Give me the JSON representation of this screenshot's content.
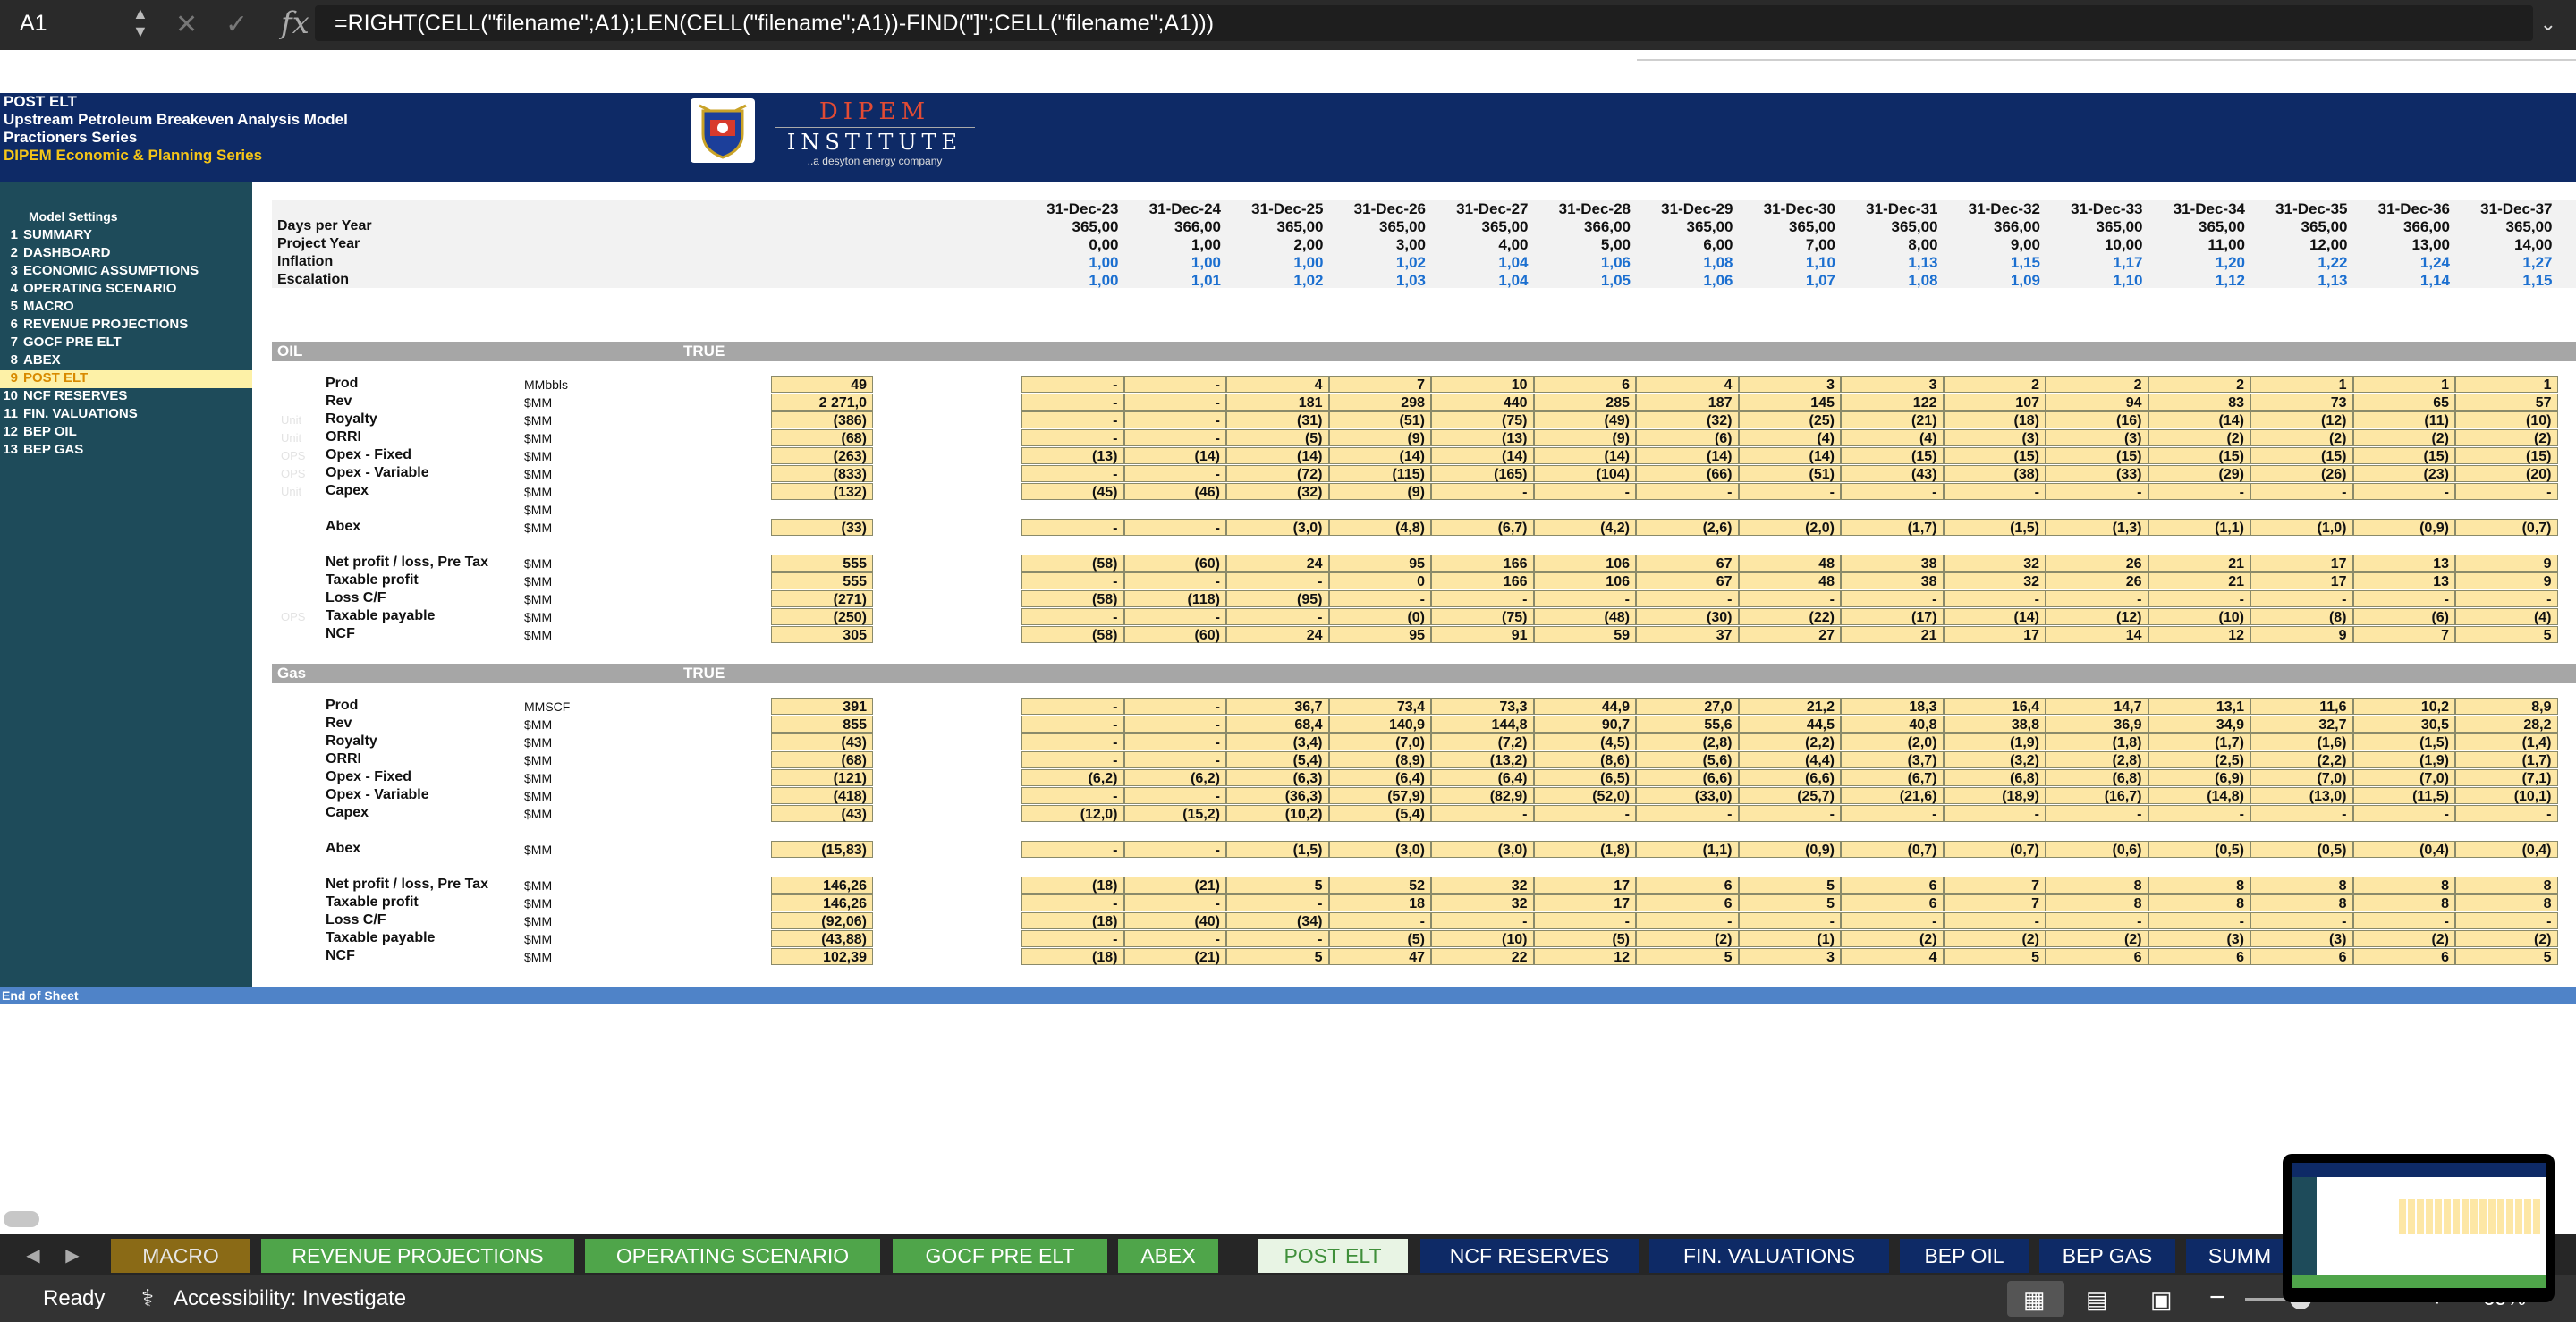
{
  "formula_bar": {
    "cell_ref": "A1",
    "fx": "fx",
    "formula": "=RIGHT(CELL(\"filename\";A1);LEN(CELL(\"filename\";A1))-FIND(\"]\";CELL(\"filename\";A1)))"
  },
  "header": {
    "sheet_name": "POST ELT",
    "title": "Upstream Petroleum Breakeven Analysis Model",
    "series1": "Practioners Series",
    "series2": "DIPEM Economic & Planning Series",
    "logo_title": "DIPEM",
    "logo_sub": "INSTITUTE",
    "logo_tagline": "..a desyton energy company"
  },
  "nav": {
    "settings_label": "Model Settings",
    "items": [
      {
        "num": "1",
        "label": "SUMMARY"
      },
      {
        "num": "2",
        "label": "DASHBOARD"
      },
      {
        "num": "3",
        "label": "ECONOMIC ASSUMPTIONS"
      },
      {
        "num": "4",
        "label": "OPERATING SCENARIO"
      },
      {
        "num": "5",
        "label": "MACRO"
      },
      {
        "num": "6",
        "label": "REVENUE PROJECTIONS"
      },
      {
        "num": "7",
        "label": "GOCF PRE ELT"
      },
      {
        "num": "8",
        "label": "ABEX"
      },
      {
        "num": "9",
        "label": "POST ELT"
      },
      {
        "num": "10",
        "label": "NCF RESERVES"
      },
      {
        "num": "11",
        "label": "FIN. VALUATIONS"
      },
      {
        "num": "12",
        "label": "BEP OIL"
      },
      {
        "num": "13",
        "label": "BEP GAS"
      }
    ],
    "active_index": 8
  },
  "dates": [
    "31-Dec-23",
    "31-Dec-24",
    "31-Dec-25",
    "31-Dec-26",
    "31-Dec-27",
    "31-Dec-28",
    "31-Dec-29",
    "31-Dec-30",
    "31-Dec-31",
    "31-Dec-32",
    "31-Dec-33",
    "31-Dec-34",
    "31-Dec-35",
    "31-Dec-36",
    "31-Dec-37"
  ],
  "header_rows": [
    {
      "label": "Days per Year",
      "blue": false,
      "values": [
        "365,00",
        "366,00",
        "365,00",
        "365,00",
        "365,00",
        "366,00",
        "365,00",
        "365,00",
        "365,00",
        "366,00",
        "365,00",
        "365,00",
        "365,00",
        "366,00",
        "365,00"
      ]
    },
    {
      "label": "Project Year",
      "blue": false,
      "values": [
        "0,00",
        "1,00",
        "2,00",
        "3,00",
        "4,00",
        "5,00",
        "6,00",
        "7,00",
        "8,00",
        "9,00",
        "10,00",
        "11,00",
        "12,00",
        "13,00",
        "14,00"
      ]
    },
    {
      "label": "Inflation",
      "blue": true,
      "values": [
        "1,00",
        "1,00",
        "1,00",
        "1,02",
        "1,04",
        "1,06",
        "1,08",
        "1,10",
        "1,13",
        "1,15",
        "1,17",
        "1,20",
        "1,22",
        "1,24",
        "1,27"
      ]
    },
    {
      "label": "Escalation",
      "blue": true,
      "values": [
        "1,00",
        "1,01",
        "1,02",
        "1,03",
        "1,04",
        "1,05",
        "1,06",
        "1,07",
        "1,08",
        "1,09",
        "1,10",
        "1,12",
        "1,13",
        "1,14",
        "1,15"
      ]
    }
  ],
  "sections": [
    {
      "name": "OIL",
      "flag": "TRUE",
      "rows": [
        {
          "ghost": "",
          "label": "Prod",
          "unit": "MMbbls",
          "total": "49",
          "values": [
            "-",
            "-",
            "4",
            "7",
            "10",
            "6",
            "4",
            "3",
            "3",
            "2",
            "2",
            "2",
            "1",
            "1",
            "1"
          ]
        },
        {
          "ghost": "",
          "label": "Rev",
          "unit": "$MM",
          "total": "2 271,0",
          "values": [
            "-",
            "-",
            "181",
            "298",
            "440",
            "285",
            "187",
            "145",
            "122",
            "107",
            "94",
            "83",
            "73",
            "65",
            "57"
          ]
        },
        {
          "ghost": "Unit",
          "label": "Royalty",
          "unit": "$MM",
          "total": "(386)",
          "values": [
            "-",
            "-",
            "(31)",
            "(51)",
            "(75)",
            "(49)",
            "(32)",
            "(25)",
            "(21)",
            "(18)",
            "(16)",
            "(14)",
            "(12)",
            "(11)",
            "(10)"
          ]
        },
        {
          "ghost": "Unit",
          "label": "ORRI",
          "unit": "$MM",
          "total": "(68)",
          "values": [
            "-",
            "-",
            "(5)",
            "(9)",
            "(13)",
            "(9)",
            "(6)",
            "(4)",
            "(4)",
            "(3)",
            "(3)",
            "(2)",
            "(2)",
            "(2)",
            "(2)"
          ]
        },
        {
          "ghost": "OPS",
          "label": "Opex - Fixed",
          "unit": "$MM",
          "total": "(263)",
          "values": [
            "(13)",
            "(14)",
            "(14)",
            "(14)",
            "(14)",
            "(14)",
            "(14)",
            "(14)",
            "(15)",
            "(15)",
            "(15)",
            "(15)",
            "(15)",
            "(15)",
            "(15)"
          ]
        },
        {
          "ghost": "OPS",
          "label": "Opex - Variable",
          "unit": "$MM",
          "total": "(833)",
          "values": [
            "-",
            "-",
            "(72)",
            "(115)",
            "(165)",
            "(104)",
            "(66)",
            "(51)",
            "(43)",
            "(38)",
            "(33)",
            "(29)",
            "(26)",
            "(23)",
            "(20)"
          ]
        },
        {
          "ghost": "Unit",
          "label": "Capex",
          "unit": "$MM",
          "total": "(132)",
          "values": [
            "(45)",
            "(46)",
            "(32)",
            "(9)",
            "-",
            "-",
            "-",
            "-",
            "-",
            "-",
            "-",
            "-",
            "-",
            "-",
            "-"
          ]
        },
        {
          "ghost": "",
          "label": "",
          "unit": "$MM",
          "total": null,
          "values": null
        },
        {
          "ghost": "",
          "label": "Abex",
          "unit": "$MM",
          "total": "(33)",
          "values": [
            "-",
            "-",
            "(3,0)",
            "(4,8)",
            "(6,7)",
            "(4,2)",
            "(2,6)",
            "(2,0)",
            "(1,7)",
            "(1,5)",
            "(1,3)",
            "(1,1)",
            "(1,0)",
            "(0,9)",
            "(0,7)"
          ]
        },
        {
          "spacer": true
        },
        {
          "ghost": "",
          "label": "Net profit / loss, Pre Tax",
          "unit": "$MM",
          "total": "555",
          "values": [
            "(58)",
            "(60)",
            "24",
            "95",
            "166",
            "106",
            "67",
            "48",
            "38",
            "32",
            "26",
            "21",
            "17",
            "13",
            "9"
          ]
        },
        {
          "ghost": "",
          "label": "Taxable profit",
          "unit": "$MM",
          "total": "555",
          "values": [
            "-",
            "-",
            "-",
            "0",
            "166",
            "106",
            "67",
            "48",
            "38",
            "32",
            "26",
            "21",
            "17",
            "13",
            "9"
          ]
        },
        {
          "ghost": "",
          "label": "Loss C/F",
          "unit": "$MM",
          "total": "(271)",
          "values": [
            "(58)",
            "(118)",
            "(95)",
            "-",
            "-",
            "-",
            "-",
            "-",
            "-",
            "-",
            "-",
            "-",
            "-",
            "-",
            "-"
          ]
        },
        {
          "ghost": "OPS",
          "label": "Taxable payable",
          "unit": "$MM",
          "total": "(250)",
          "values": [
            "-",
            "-",
            "-",
            "(0)",
            "(75)",
            "(48)",
            "(30)",
            "(22)",
            "(17)",
            "(14)",
            "(12)",
            "(10)",
            "(8)",
            "(6)",
            "(4)"
          ]
        },
        {
          "ghost": "",
          "label": "NCF",
          "unit": "$MM",
          "total": "305",
          "values": [
            "(58)",
            "(60)",
            "24",
            "95",
            "91",
            "59",
            "37",
            "27",
            "21",
            "17",
            "14",
            "12",
            "9",
            "7",
            "5"
          ]
        }
      ]
    },
    {
      "name": "Gas",
      "flag": "TRUE",
      "rows": [
        {
          "ghost": "",
          "label": "Prod",
          "unit": "MMSCF",
          "total": "391",
          "values": [
            "-",
            "-",
            "36,7",
            "73,4",
            "73,3",
            "44,9",
            "27,0",
            "21,2",
            "18,3",
            "16,4",
            "14,7",
            "13,1",
            "11,6",
            "10,2",
            "8,9"
          ]
        },
        {
          "ghost": "",
          "label": "Rev",
          "unit": "$MM",
          "total": "855",
          "values": [
            "-",
            "-",
            "68,4",
            "140,9",
            "144,8",
            "90,7",
            "55,6",
            "44,5",
            "40,8",
            "38,8",
            "36,9",
            "34,9",
            "32,7",
            "30,5",
            "28,2"
          ]
        },
        {
          "ghost": "",
          "label": "Royalty",
          "unit": "$MM",
          "total": "(43)",
          "values": [
            "-",
            "-",
            "(3,4)",
            "(7,0)",
            "(7,2)",
            "(4,5)",
            "(2,8)",
            "(2,2)",
            "(2,0)",
            "(1,9)",
            "(1,8)",
            "(1,7)",
            "(1,6)",
            "(1,5)",
            "(1,4)"
          ]
        },
        {
          "ghost": "",
          "label": "ORRI",
          "unit": "$MM",
          "total": "(68)",
          "values": [
            "-",
            "-",
            "(5,4)",
            "(8,9)",
            "(13,2)",
            "(8,6)",
            "(5,6)",
            "(4,4)",
            "(3,7)",
            "(3,2)",
            "(2,8)",
            "(2,5)",
            "(2,2)",
            "(1,9)",
            "(1,7)"
          ]
        },
        {
          "ghost": "",
          "label": "Opex - Fixed",
          "unit": "$MM",
          "total": "(121)",
          "values": [
            "(6,2)",
            "(6,2)",
            "(6,3)",
            "(6,4)",
            "(6,4)",
            "(6,5)",
            "(6,6)",
            "(6,6)",
            "(6,7)",
            "(6,8)",
            "(6,8)",
            "(6,9)",
            "(7,0)",
            "(7,0)",
            "(7,1)"
          ]
        },
        {
          "ghost": "",
          "label": "Opex - Variable",
          "unit": "$MM",
          "total": "(418)",
          "values": [
            "-",
            "-",
            "(36,3)",
            "(57,9)",
            "(82,9)",
            "(52,0)",
            "(33,0)",
            "(25,7)",
            "(21,6)",
            "(18,9)",
            "(16,7)",
            "(14,8)",
            "(13,0)",
            "(11,5)",
            "(10,1)"
          ]
        },
        {
          "ghost": "",
          "label": "Capex",
          "unit": "$MM",
          "total": "(43)",
          "values": [
            "(12,0)",
            "(15,2)",
            "(10,2)",
            "(5,4)",
            "-",
            "-",
            "-",
            "-",
            "-",
            "-",
            "-",
            "-",
            "-",
            "-",
            "-"
          ]
        },
        {
          "spacer": true
        },
        {
          "ghost": "",
          "label": "Abex",
          "unit": "$MM",
          "total": "(15,83)",
          "values": [
            "-",
            "-",
            "(1,5)",
            "(3,0)",
            "(3,0)",
            "(1,8)",
            "(1,1)",
            "(0,9)",
            "(0,7)",
            "(0,7)",
            "(0,6)",
            "(0,5)",
            "(0,5)",
            "(0,4)",
            "(0,4)"
          ]
        },
        {
          "spacer": true
        },
        {
          "ghost": "",
          "label": "Net profit / loss, Pre Tax",
          "unit": "$MM",
          "total": "146,26",
          "values": [
            "(18)",
            "(21)",
            "5",
            "52",
            "32",
            "17",
            "6",
            "5",
            "6",
            "7",
            "8",
            "8",
            "8",
            "8",
            "8"
          ]
        },
        {
          "ghost": "",
          "label": "Taxable profit",
          "unit": "$MM",
          "total": "146,26",
          "values": [
            "-",
            "-",
            "-",
            "18",
            "32",
            "17",
            "6",
            "5",
            "6",
            "7",
            "8",
            "8",
            "8",
            "8",
            "8"
          ]
        },
        {
          "ghost": "",
          "label": "Loss C/F",
          "unit": "$MM",
          "total": "(92,06)",
          "values": [
            "(18)",
            "(40)",
            "(34)",
            "-",
            "-",
            "-",
            "-",
            "-",
            "-",
            "-",
            "-",
            "-",
            "-",
            "-",
            "-"
          ]
        },
        {
          "ghost": "",
          "label": "Taxable payable",
          "unit": "$MM",
          "total": "(43,88)",
          "values": [
            "-",
            "-",
            "-",
            "(5)",
            "(10)",
            "(5)",
            "(2)",
            "(1)",
            "(2)",
            "(2)",
            "(2)",
            "(3)",
            "(3)",
            "(2)",
            "(2)"
          ]
        },
        {
          "ghost": "",
          "label": "NCF",
          "unit": "$MM",
          "total": "102,39",
          "values": [
            "(18)",
            "(21)",
            "5",
            "47",
            "22",
            "12",
            "5",
            "3",
            "4",
            "5",
            "6",
            "6",
            "6",
            "6",
            "5"
          ]
        }
      ]
    }
  ],
  "end_of_sheet": "End of Sheet",
  "tabs": [
    {
      "label": "MACRO",
      "bg": "#8a6a16",
      "fg": "#e6e6e6"
    },
    {
      "label": "REVENUE PROJECTIONS",
      "bg": "#4fa54a",
      "fg": "#ffffff"
    },
    {
      "label": "OPERATING SCENARIO",
      "bg": "#4fa54a",
      "fg": "#ffffff"
    },
    {
      "label": "GOCF  PRE ELT",
      "bg": "#4fa54a",
      "fg": "#ffffff"
    },
    {
      "label": "ABEX",
      "bg": "#4fa54a",
      "fg": "#ffffff"
    },
    {
      "label": "POST ELT",
      "bg": "#e8f4e4",
      "fg": "#3f8f3a"
    },
    {
      "label": "NCF RESERVES",
      "bg": "#0e2a66",
      "fg": "#ffffff"
    },
    {
      "label": "FIN. VALUATIONS",
      "bg": "#0e2a66",
      "fg": "#ffffff"
    },
    {
      "label": "BEP OIL",
      "bg": "#0e2a66",
      "fg": "#ffffff"
    },
    {
      "label": "BEP GAS",
      "bg": "#0e2a66",
      "fg": "#ffffff"
    },
    {
      "label": "SUMM",
      "bg": "#0e2a66",
      "fg": "#ffffff"
    }
  ],
  "status": {
    "ready": "Ready",
    "accessibility": "Accessibility: Investigate",
    "zoom": "69%"
  },
  "colors": {
    "header_bg": "#0e2a66",
    "panel_bg": "#1e4b5a",
    "input_cell": "#fde7a5",
    "section_bg": "#a6a6a6",
    "blue_values": "#1b6fd0"
  }
}
